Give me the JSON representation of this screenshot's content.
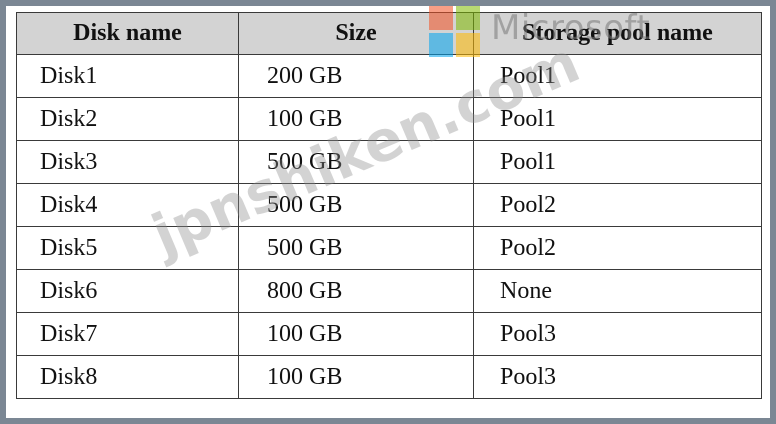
{
  "table": {
    "headers": [
      "Disk name",
      "Size",
      "Storage pool name"
    ],
    "rows": [
      [
        "Disk1",
        "200 GB",
        "Pool1"
      ],
      [
        "Disk2",
        "100 GB",
        "Pool1"
      ],
      [
        "Disk3",
        "500 GB",
        "Pool1"
      ],
      [
        "Disk4",
        "500 GB",
        "Pool2"
      ],
      [
        "Disk5",
        "500 GB",
        "Pool2"
      ],
      [
        "Disk6",
        "800 GB",
        "None"
      ],
      [
        "Disk7",
        "100 GB",
        "Pool3"
      ],
      [
        "Disk8",
        "100 GB",
        "Pool3"
      ]
    ]
  },
  "watermark": {
    "logo_text": "Microsoft",
    "site_text": "jpnshiken.com"
  }
}
